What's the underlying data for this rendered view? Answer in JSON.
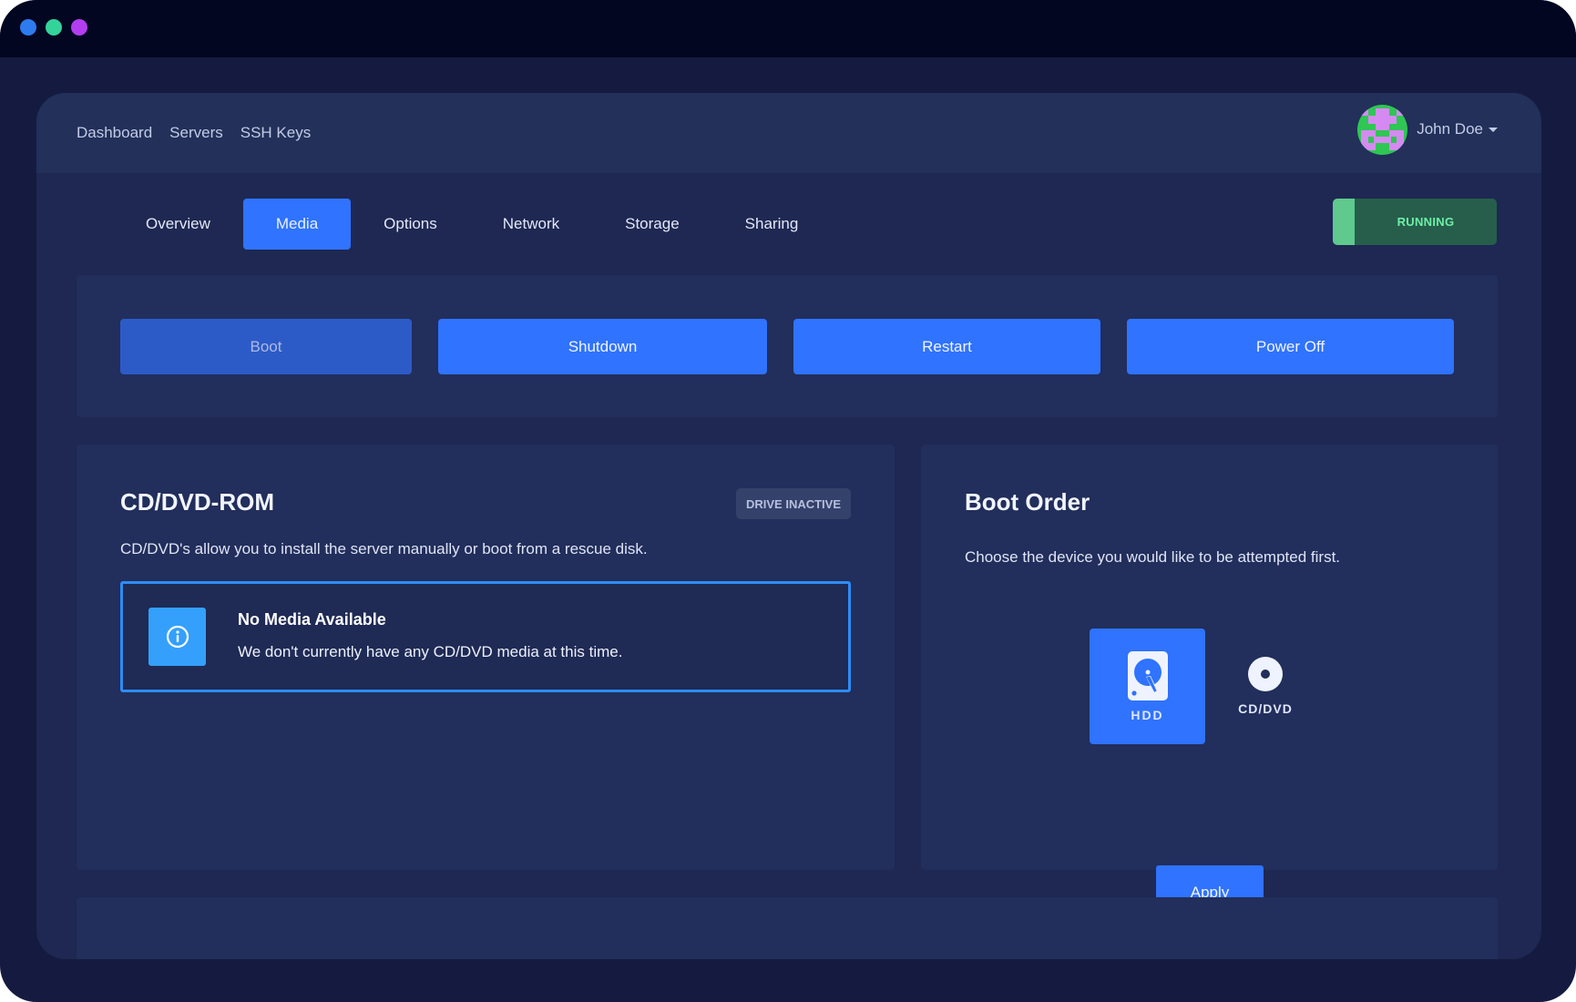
{
  "window": {
    "traffic_lights": [
      "blue",
      "green",
      "purple"
    ]
  },
  "header": {
    "nav": [
      {
        "label": "Dashboard"
      },
      {
        "label": "Servers"
      },
      {
        "label": "SSH Keys"
      }
    ],
    "user": {
      "name": "John Doe",
      "avatar_icon": "identicon-avatar",
      "menu_icon": "caret-down-icon"
    }
  },
  "tabs": [
    {
      "label": "Overview",
      "active": false
    },
    {
      "label": "Media",
      "active": true
    },
    {
      "label": "Options",
      "active": false
    },
    {
      "label": "Network",
      "active": false
    },
    {
      "label": "Storage",
      "active": false
    },
    {
      "label": "Sharing",
      "active": false
    }
  ],
  "status": {
    "label": "RUNNING",
    "color": "#6ef0a7"
  },
  "actions": [
    {
      "label": "Boot",
      "disabled": true
    },
    {
      "label": "Shutdown",
      "disabled": false
    },
    {
      "label": "Restart",
      "disabled": false
    },
    {
      "label": "Power Off",
      "disabled": false
    }
  ],
  "cdrom": {
    "title": "CD/DVD-ROM",
    "badge": "DRIVE INACTIVE",
    "description": "CD/DVD's allow you to install the server manually or boot from a rescue disk.",
    "notice": {
      "icon": "info-icon",
      "title": "No Media Available",
      "text": "We don't currently have any CD/DVD media at this time."
    }
  },
  "boot_order": {
    "title": "Boot Order",
    "description": "Choose the device you would like to be attempted first.",
    "devices": [
      {
        "label": "HDD",
        "icon": "hard-drive-icon",
        "selected": true
      },
      {
        "label": "CD/DVD",
        "icon": "disc-icon",
        "selected": false
      }
    ],
    "apply_label": "Apply"
  },
  "colors": {
    "accent": "#2f73fe",
    "background": "#1e2852",
    "panel": "#222e5b",
    "info": "#34a0fb",
    "running": "#265e4b"
  }
}
